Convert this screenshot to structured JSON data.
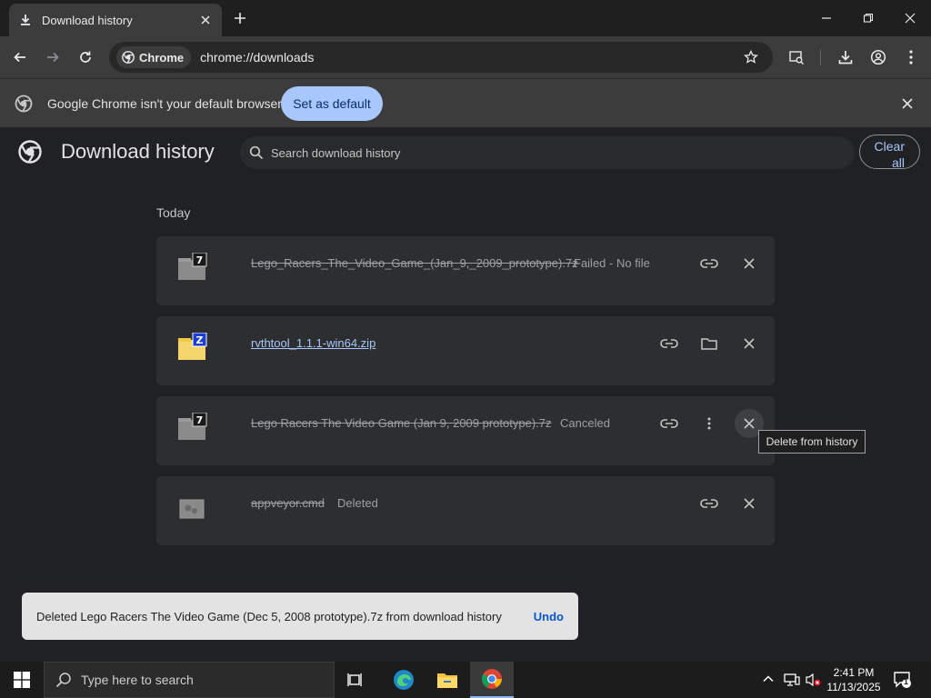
{
  "tab": {
    "title": "Download history"
  },
  "toolbar": {
    "chip_label": "Chrome",
    "url": "chrome://downloads"
  },
  "infobar": {
    "message": "Google Chrome isn't your default browser",
    "button_label": "Set as default"
  },
  "header": {
    "title": "Download history",
    "search_placeholder": "Search download history",
    "clear_all_label": "Clear all"
  },
  "section": {
    "date": "Today"
  },
  "downloads": [
    {
      "name": "Lego_Racers_The_Video_Game_(Jan_9,_2009_prototype).7z",
      "status": "Failed - No file",
      "icon": "7z-file-icon-gray"
    },
    {
      "name": "rvthtool_1.1.1-win64.zip",
      "status": "",
      "icon": "zip-folder-icon"
    },
    {
      "name": "Lego Racers The Video Game (Jan 9, 2009 prototype).7z",
      "status": "Canceled",
      "icon": "7z-file-icon-gray"
    },
    {
      "name": "appveyor.cmd",
      "status": "Deleted",
      "icon": "cmd-file-icon-gray"
    }
  ],
  "tooltip": {
    "text": "Delete from history"
  },
  "toast": {
    "message": "Deleted Lego Racers The Video Game (Dec 5, 2008 prototype).7z from download history",
    "undo_label": "Undo"
  },
  "taskbar": {
    "search_placeholder": "Type here to search",
    "time": "2:41 PM",
    "date": "11/13/2025",
    "notification_count": "1"
  },
  "colors": {
    "accent": "#a8c7fa",
    "card_bg": "#2d2e30",
    "page_bg": "#202124"
  }
}
